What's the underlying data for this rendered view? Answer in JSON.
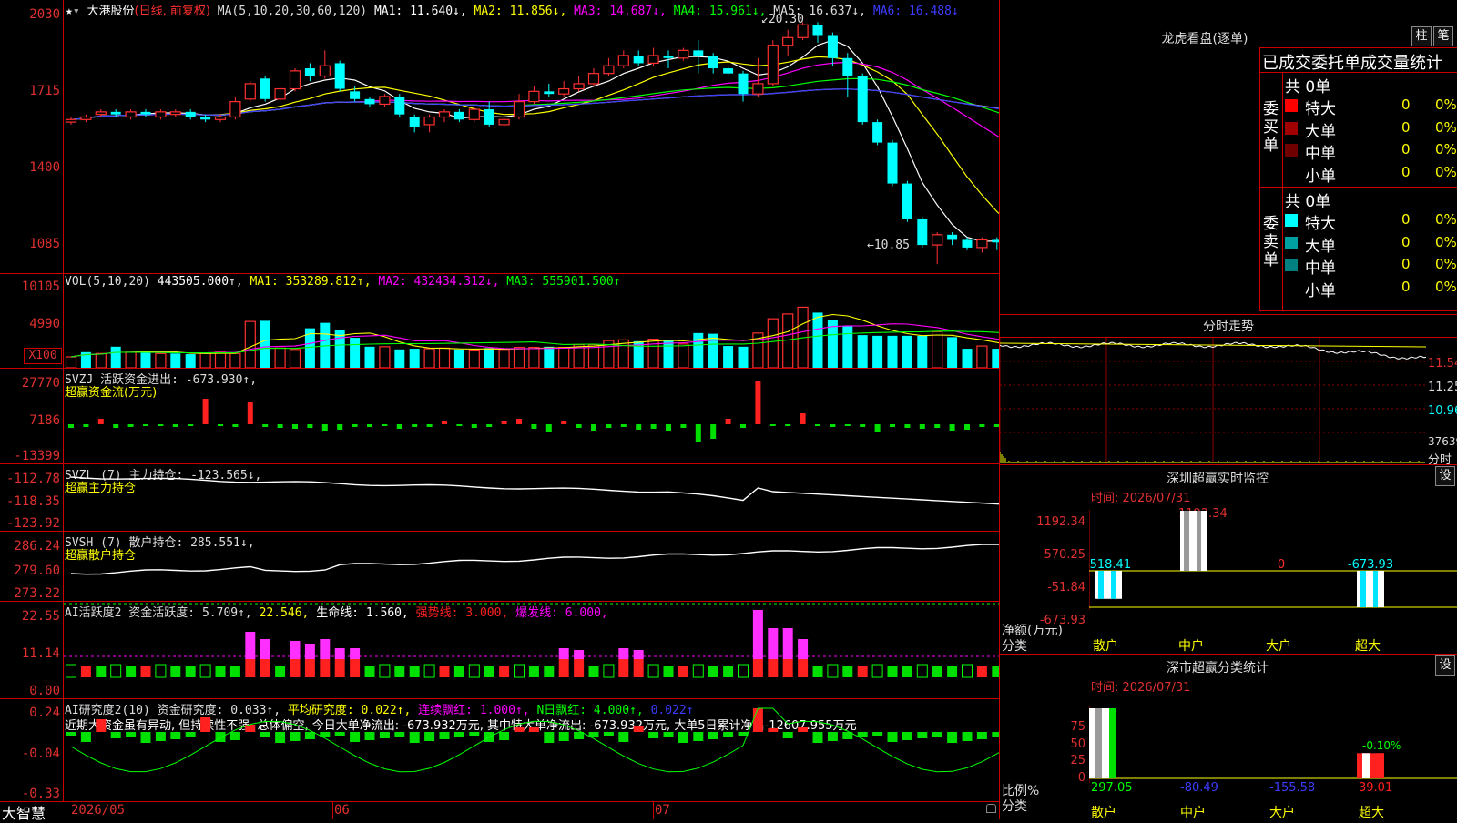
{
  "app_name": "大智慧",
  "stock": {
    "name": "大港股份",
    "period": "(日线, 前复权)"
  },
  "ma_line": {
    "label": "MA(5,10,20,30,60,120)",
    "items": [
      {
        "text": "MA1: 11.640↓,",
        "color": "#ffffff"
      },
      {
        "text": "MA2: 11.856↓,",
        "color": "#ffff00"
      },
      {
        "text": "MA3: 14.687↓,",
        "color": "#ff00ff"
      },
      {
        "text": "MA4: 15.961↓,",
        "color": "#00ff00"
      },
      {
        "text": "MA5: 16.637↓,",
        "color": "#dddddd"
      },
      {
        "text": "MA6: 16.488↓",
        "color": "#3c3cff"
      }
    ]
  },
  "price_axis": [
    "2030",
    "1715",
    "1400",
    "1085"
  ],
  "price_annotations": {
    "high": "20.30",
    "low": "10.85"
  },
  "vol": {
    "label": "VOL(5,10,20)",
    "value": "443505.000↑,",
    "items": [
      {
        "text": "MA1: 353289.812↑,",
        "color": "#ffff00"
      },
      {
        "text": "MA2: 432434.312↓,",
        "color": "#ff00ff"
      },
      {
        "text": "MA3: 555901.500↑",
        "color": "#00ff00"
      }
    ],
    "axis": [
      "10105",
      "4990"
    ],
    "unit_button": "X100"
  },
  "svzj": {
    "label": "SVZJ  活跃资金进出: -673.930↑,",
    "sub": "超赢资金流(万元)",
    "axis": [
      "27770",
      "7186",
      "-13399"
    ]
  },
  "svzl": {
    "label": "SVZL  (7) 主力持仓: -123.565↓,",
    "sub": "超赢主力持仓",
    "axis": [
      "-112.78",
      "-118.35",
      "-123.92"
    ]
  },
  "svsh": {
    "label": "SVSH  (7) 散户持仓: 285.551↓,",
    "sub": "超赢散户持仓",
    "axis": [
      "286.24",
      "279.60",
      "273.22"
    ]
  },
  "ai_active": {
    "label": "AI活跃度2 资金活跃度: 5.709↑,",
    "items": [
      {
        "text": "22.546,",
        "color": "#ffff00"
      },
      {
        "text": "生命线: 1.560,",
        "color": "#ffffff"
      },
      {
        "text": "强势线: 3.000,",
        "color": "#ff2020"
      },
      {
        "text": "爆发线: 6.000,",
        "color": "#ff00ff"
      }
    ],
    "axis": [
      "22.55",
      "11.14",
      "0.00"
    ]
  },
  "ai_research": {
    "label": "AI研究度2(10) 资金研究度: 0.033↑,",
    "items": [
      {
        "text": "平均研究度: 0.022↑,",
        "color": "#ffff00"
      },
      {
        "text": "连续飘红: 1.000↑,",
        "color": "#ff00ff"
      },
      {
        "text": "N日飘红: 4.000↑,",
        "color": "#00ff00"
      },
      {
        "text": "0.022↑",
        "color": "#3c3cff"
      }
    ],
    "comment": "近期大资金虽有异动, 但持续性不强, 总体偏空, 今日大单净流出: -673.932万元, 其中特大单净流出: -673.932万元, 大单5日累计净出-12607.955万元",
    "axis": [
      "0.24",
      "-0.04",
      "-0.33"
    ]
  },
  "date_axis": [
    "2026/05",
    "06",
    "07"
  ],
  "right_panel": {
    "longhu": {
      "title": "龙虎看盘(逐单)",
      "btn1": "柱",
      "btn2": "笔"
    },
    "order_stats": {
      "header": "已成交委托单成交量统计",
      "buy": {
        "label": "委买单",
        "count": "共 0单",
        "rows": [
          {
            "name": "特大",
            "vol": "0",
            "pct": "0%",
            "color": "#ff0000"
          },
          {
            "name": "大单",
            "vol": "0",
            "pct": "0%",
            "color": "#a00000"
          },
          {
            "name": "中单",
            "vol": "0",
            "pct": "0%",
            "color": "#700000"
          },
          {
            "name": "小单",
            "vol": "0",
            "pct": "0%",
            "color": ""
          }
        ]
      },
      "sell": {
        "label": "委卖单",
        "count": "共 0单",
        "rows": [
          {
            "name": "特大",
            "vol": "0",
            "pct": "0%",
            "color": "#00ffff"
          },
          {
            "name": "大单",
            "vol": "0",
            "pct": "0%",
            "color": "#00a0a0"
          },
          {
            "name": "中单",
            "vol": "0",
            "pct": "0%",
            "color": "#008080"
          },
          {
            "name": "小单",
            "vol": "0",
            "pct": "0%",
            "color": ""
          }
        ]
      }
    },
    "intraday": {
      "title": "分时走势",
      "axis": [
        "11.54",
        "11.25",
        "10.96"
      ],
      "vol_label": "37639",
      "vol_unit": "分时"
    },
    "monitor": {
      "title": "深圳超赢实时监控",
      "btn": "设",
      "time": "时间: 2026/07/31",
      "axis": [
        "1192.34",
        "570.25",
        "-51.84",
        "-673.93"
      ],
      "top_value": "1192.34",
      "bars": [
        {
          "cat": "散户",
          "value": -518.41,
          "label": "-518.41"
        },
        {
          "cat": "中户",
          "value": 1192.34,
          "label": ""
        },
        {
          "cat": "大户",
          "value": 0,
          "label": "0"
        },
        {
          "cat": "超大",
          "value": -673.93,
          "label": "-673.93"
        }
      ],
      "ylabel": "净额(万元)",
      "xlabel": "分类"
    },
    "classify": {
      "title": "深市超赢分类统计",
      "btn": "设",
      "time": "时间: 2026/07/31",
      "axis": [
        "75",
        "50",
        "25",
        "0"
      ],
      "bars": [
        {
          "cat": "散户",
          "pct": 100,
          "label": "297.05",
          "labelcolor": "#00ff00"
        },
        {
          "cat": "中户",
          "pct": 0,
          "label": "-80.49",
          "labelcolor": "#3c3cff"
        },
        {
          "cat": "大户",
          "pct": 0,
          "label": "-155.58",
          "labelcolor": "#3c3cff"
        },
        {
          "cat": "超大",
          "pct": 36,
          "label": "39.01",
          "labelcolor": "#ff2020"
        }
      ],
      "pct_label": "-0.10%",
      "ylabel": "比例%",
      "xlabel": "分类"
    }
  },
  "chart_data": [
    {
      "type": "candlestick",
      "title": "大港股份 (日线, 前复权)",
      "x": [
        "2026/05",
        "06",
        "07"
      ],
      "ylim": [
        10.5,
        20.6
      ],
      "ohlc": [
        [
          16.4,
          16.5,
          16.3,
          16.6
        ],
        [
          16.5,
          16.6,
          16.4,
          16.7
        ],
        [
          16.7,
          16.8,
          16.6,
          16.9
        ],
        [
          16.8,
          16.7,
          16.6,
          16.9
        ],
        [
          16.6,
          16.8,
          16.5,
          16.9
        ],
        [
          16.8,
          16.7,
          16.6,
          16.9
        ],
        [
          16.6,
          16.8,
          16.5,
          16.9
        ],
        [
          16.7,
          16.8,
          16.6,
          16.9
        ],
        [
          16.8,
          16.6,
          16.5,
          16.9
        ],
        [
          16.6,
          16.5,
          16.4,
          16.7
        ],
        [
          16.5,
          16.6,
          16.4,
          16.7
        ],
        [
          16.6,
          17.2,
          16.5,
          17.4
        ],
        [
          17.3,
          17.9,
          17.2,
          18.0
        ],
        [
          18.1,
          17.3,
          17.2,
          18.2
        ],
        [
          17.3,
          17.7,
          17.2,
          17.8
        ],
        [
          17.7,
          18.4,
          17.6,
          18.5
        ],
        [
          18.5,
          18.2,
          18.0,
          18.7
        ],
        [
          18.2,
          18.6,
          18.1,
          19.2
        ],
        [
          18.7,
          17.7,
          17.6,
          18.8
        ],
        [
          17.6,
          17.3,
          17.2,
          17.8
        ],
        [
          17.3,
          17.1,
          17.0,
          17.4
        ],
        [
          17.1,
          17.4,
          17.0,
          17.5
        ],
        [
          17.4,
          16.7,
          16.6,
          17.5
        ],
        [
          16.6,
          16.2,
          16.0,
          16.7
        ],
        [
          16.3,
          16.6,
          16.0,
          16.7
        ],
        [
          16.6,
          16.8,
          16.4,
          16.9
        ],
        [
          16.8,
          16.5,
          16.4,
          16.9
        ],
        [
          16.5,
          16.9,
          16.4,
          17.0
        ],
        [
          16.9,
          16.3,
          16.2,
          17.2
        ],
        [
          16.3,
          16.5,
          16.2,
          16.6
        ],
        [
          16.6,
          17.2,
          16.5,
          17.5
        ],
        [
          17.2,
          17.6,
          17.1,
          17.8
        ],
        [
          17.6,
          17.5,
          17.4,
          17.9
        ],
        [
          17.5,
          17.7,
          17.4,
          18.0
        ],
        [
          17.7,
          17.9,
          17.6,
          18.2
        ],
        [
          17.9,
          18.3,
          17.8,
          18.5
        ],
        [
          18.3,
          18.6,
          18.2,
          18.9
        ],
        [
          18.6,
          19.0,
          18.5,
          19.2
        ],
        [
          19.0,
          18.7,
          18.6,
          19.2
        ],
        [
          18.7,
          19.0,
          18.6,
          19.3
        ],
        [
          19.0,
          18.9,
          18.5,
          19.2
        ],
        [
          18.9,
          19.2,
          18.8,
          19.3
        ],
        [
          19.2,
          19.0,
          18.3,
          19.6
        ],
        [
          19.0,
          18.5,
          18.3,
          19.1
        ],
        [
          18.5,
          18.3,
          18.2,
          18.6
        ],
        [
          18.3,
          17.5,
          17.2,
          18.4
        ],
        [
          17.5,
          17.9,
          17.4,
          18.9
        ],
        [
          17.9,
          19.4,
          17.8,
          19.6
        ],
        [
          19.4,
          19.7,
          19.0,
          20.0
        ],
        [
          19.7,
          20.2,
          19.6,
          20.3
        ],
        [
          20.2,
          19.8,
          19.5,
          20.3
        ],
        [
          19.8,
          18.9,
          18.6,
          19.9
        ],
        [
          18.9,
          18.2,
          17.4,
          19.1
        ],
        [
          18.2,
          16.4,
          16.3,
          18.3
        ],
        [
          16.4,
          15.6,
          15.5,
          16.5
        ],
        [
          15.6,
          14.0,
          13.9,
          15.7
        ],
        [
          14.0,
          12.6,
          12.5,
          14.1
        ],
        [
          12.6,
          11.6,
          11.5,
          12.7
        ],
        [
          11.6,
          12.0,
          10.85,
          12.1
        ],
        [
          12.0,
          11.8,
          11.6,
          12.1
        ],
        [
          11.8,
          11.5,
          11.4,
          11.9
        ],
        [
          11.5,
          11.8,
          11.3,
          11.9
        ],
        [
          11.8,
          11.7,
          11.4,
          11.9
        ],
        [
          11.7,
          11.4,
          11.2,
          11.8
        ],
        [
          11.4,
          11.2,
          11.0,
          11.5
        ],
        [
          11.2,
          11.0,
          10.9,
          11.3
        ],
        [
          11.0,
          11.3,
          10.9,
          11.6
        ]
      ]
    },
    {
      "type": "bar",
      "title": "VOL(5,10,20)",
      "ylim": [
        0,
        11500
      ],
      "values": [
        1600,
        2300,
        2100,
        3100,
        2300,
        2200,
        2100,
        2100,
        2000,
        2100,
        2300,
        2100,
        6800,
        6900,
        2900,
        2700,
        5800,
        6600,
        5600,
        4400,
        3100,
        3100,
        2700,
        2800,
        2800,
        2900,
        2700,
        2600,
        2900,
        2700,
        3000,
        3000,
        3100,
        3000,
        3400,
        3400,
        4000,
        4100,
        3900,
        4200,
        4000,
        3500,
        5100,
        5000,
        3200,
        3100,
        5100,
        7200,
        7900,
        8900,
        8100,
        7000,
        6200,
        4800,
        4700,
        4700,
        4700,
        4700,
        5300,
        4500,
        2800,
        3200,
        2800,
        3000,
        2800,
        2500,
        3200
      ],
      "up": [
        1,
        0,
        1,
        0,
        1,
        0,
        1,
        0,
        0,
        1,
        1,
        1,
        1,
        0,
        1,
        1,
        0,
        0,
        0,
        0,
        0,
        1,
        0,
        0,
        1,
        1,
        0,
        1,
        0,
        1,
        1,
        1,
        0,
        1,
        1,
        1,
        1,
        1,
        0,
        1,
        0,
        1,
        0,
        0,
        0,
        0,
        1,
        1,
        1,
        1,
        0,
        0,
        0,
        0,
        0,
        0,
        0,
        0,
        1,
        0,
        0,
        1,
        0,
        0,
        0,
        0,
        1
      ]
    }
  ]
}
